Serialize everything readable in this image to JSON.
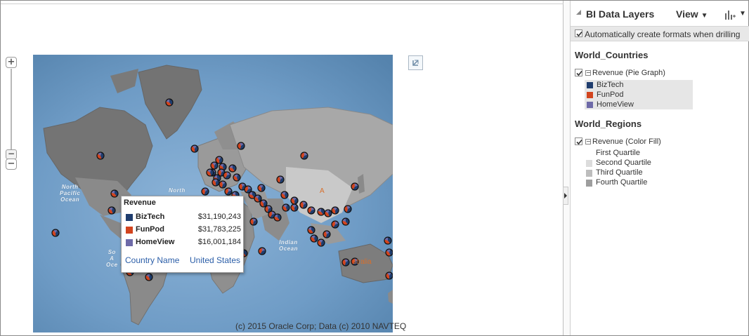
{
  "map": {
    "copyright": "(c) 2015 Oracle Corp; Data (c) 2010 NAVTEQ",
    "zoom_in_symbol": "+",
    "zoom_out_symbol": "−",
    "overview_icon": "collapse-overview-icon",
    "ocean_labels": {
      "north_pacific": "North\nPacific\nOcean",
      "north_atlantic": "North",
      "south_atlantic": "So\nA\nOce",
      "indian": "Indian\nOcean"
    },
    "land_labels": {
      "asia_partial": "A",
      "australia_partial": "stralia"
    },
    "tooltip": {
      "title": "Revenue",
      "rows": [
        {
          "name": "BizTech",
          "value": "$31,190,243",
          "color": "#1f3d6e"
        },
        {
          "name": "FunPod",
          "value": "$31,783,225",
          "color": "#d2441e"
        },
        {
          "name": "HomeView",
          "value": "$16,001,184",
          "color": "#6e6aa8"
        }
      ],
      "link_label": "Country Name",
      "link_value": "United States"
    }
  },
  "layers_panel": {
    "title": "BI Data Layers",
    "view_menu": "View",
    "auto_format_label": "Automatically create formats when drilling",
    "auto_format_checked": true,
    "layers": [
      {
        "title": "World_Countries",
        "format": "Revenue (Pie Graph)",
        "checked": true,
        "legend": [
          {
            "name": "BizTech",
            "color": "#1f3d6e"
          },
          {
            "name": "FunPod",
            "color": "#d2441e"
          },
          {
            "name": "HomeView",
            "color": "#6e6aa8"
          }
        ]
      },
      {
        "title": "World_Regions",
        "format": "Revenue (Color Fill)",
        "checked": true,
        "legend": [
          {
            "name": "First Quartile",
            "color": "#ffffff"
          },
          {
            "name": "Second Quartile",
            "color": "#dcdcdc"
          },
          {
            "name": "Third Quartile",
            "color": "#bdbdbd"
          },
          {
            "name": "Fourth Quartile",
            "color": "#9e9e9e"
          }
        ]
      }
    ]
  },
  "colors": {
    "ocean": "#6f9cc6",
    "land": "#757575",
    "land_light": "#b8b8b8",
    "accent_link": "#2b5ea8"
  }
}
